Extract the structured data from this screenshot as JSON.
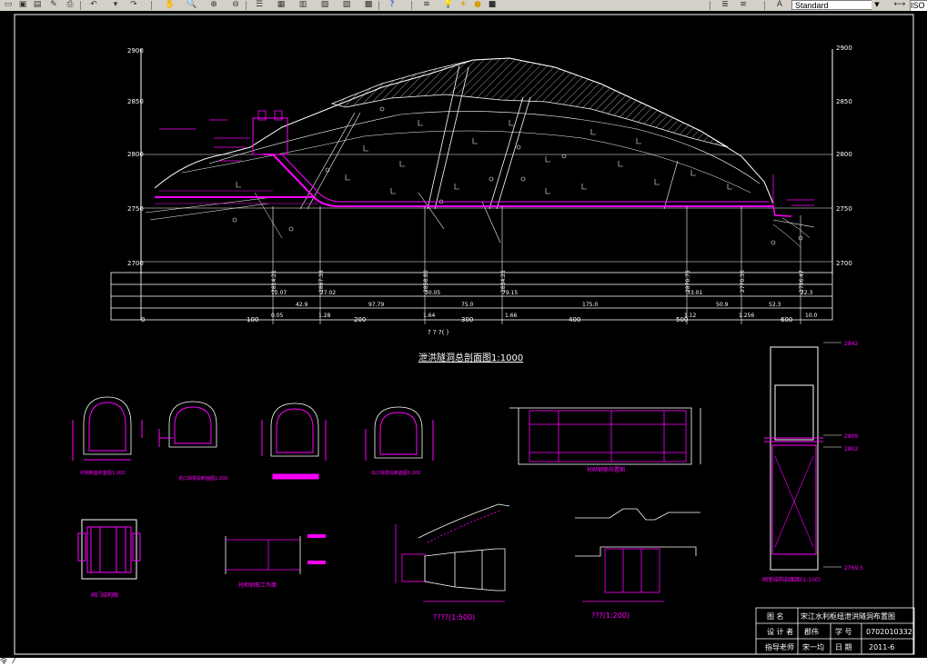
{
  "toolbar": {
    "text_style": "Standard",
    "dim_style_prefix": "ISO"
  },
  "drawing": {
    "title": "泄洪隧洞总剖面图1:1000",
    "elev_ticks": [
      "2900",
      "2850",
      "2800",
      "2750",
      "2700"
    ],
    "chainage_ticks": [
      "0",
      "100",
      "200",
      "300",
      "400",
      "500",
      "600"
    ],
    "axis_caption": "?    ?    ?(     )",
    "station_labels": [
      "2814.21",
      "2867.38",
      "2858.80",
      "2834.25",
      "2870.75",
      "2770.36",
      "2756.47"
    ],
    "table_values": [
      "12.07",
      "42.9",
      "27.02",
      "97.79",
      "10.05",
      "75.0",
      "79.15",
      "175.0",
      "33.01",
      "50.9",
      "52.3",
      "22.3"
    ],
    "table_bottom": [
      "0.05",
      "1.28",
      "1.64",
      "1.66",
      "1.12",
      "1.256",
      "10.0"
    ],
    "sub_captions": [
      "衬砌断面布置图1:200",
      "进口渐变段断面图1:200",
      "出口渐变段断面图1:200",
      "出口渐变段断面图1:200",
      "衬砌钢筋布置图",
      "闸门结构图",
      "衬砌钢筋工作面",
      "????(1:500)",
      "???(1:200)",
      "闸室结构剖面图(1:100)"
    ],
    "right_elevs": [
      "2842",
      "2809",
      "2802",
      "2769.5"
    ]
  },
  "title_block": {
    "r1_label": "图      名",
    "r1_value": "宋江水利枢纽泄洪隧洞布置图",
    "r2_label": "设 计 者",
    "r2_name": "郡伟",
    "r2_label2": "学 号",
    "r2_id": "0702010332",
    "r3_label": "指导老师",
    "r3_name": "宋一均",
    "r3_label2": "日 期",
    "r3_date": "2011-6"
  },
  "command": {
    "prompt": "令 /"
  },
  "colors": {
    "magenta": "#ff00ff",
    "white": "#ffffff",
    "background": "#000000"
  }
}
